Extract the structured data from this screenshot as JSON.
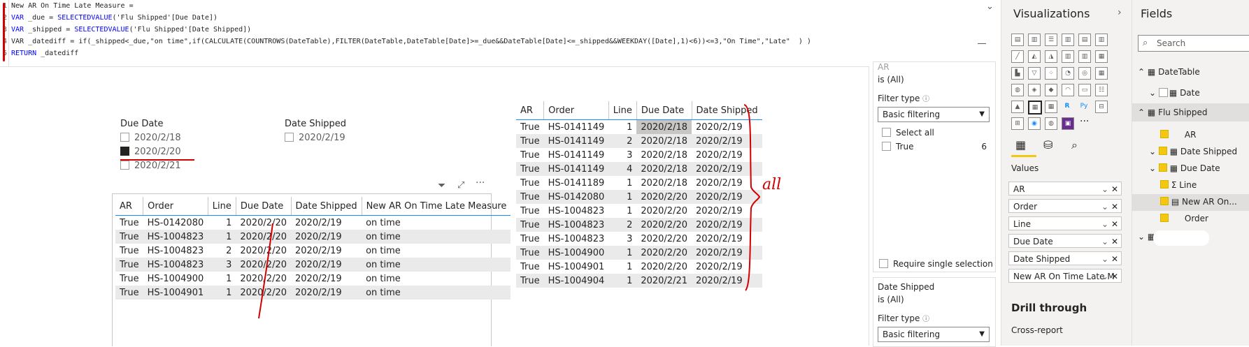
{
  "formula": {
    "line1": {
      "num": "1",
      "text": "New AR On Time Late Measure ="
    },
    "line2": {
      "num": "2",
      "kw": "VAR",
      "name": " _due = ",
      "fn": "SELECTEDVALUE",
      "arg": "('Flu Shipped'[Due Date])"
    },
    "line3": {
      "num": "3",
      "kw": "VAR",
      "name": " _shipped = ",
      "fn": "SELECTEDVALUE",
      "arg": "('Flu Shipped'[Date Shipped])"
    },
    "line4": {
      "num": "4",
      "text": "VAR _datediff = if(_shipped<_due,\"on time\",if(CALCULATE(COUNTROWS(DateTable),FILTER(DateTable,DateTable[Date]>=_due&&DateTable[Date]<=_shipped&&WEEKDAY([Date],1)<6))<=3,\"On Time\",\"Late\"  ) )"
    },
    "line5": {
      "num": "5",
      "kw": "RETURN",
      "name": " _datediff"
    }
  },
  "slicer_due": {
    "title": "Due Date",
    "items": [
      {
        "label": "2020/2/18",
        "checked": false
      },
      {
        "label": "2020/2/20",
        "checked": true
      },
      {
        "label": "2020/2/21",
        "checked": false
      }
    ]
  },
  "slicer_shipped": {
    "title": "Date Shipped",
    "items": [
      {
        "label": "2020/2/19",
        "checked": false
      }
    ]
  },
  "table_left": {
    "headers": [
      "AR",
      "Order",
      "Line",
      "Due Date",
      "Date Shipped",
      "New AR On Time Late Measure"
    ],
    "rows": [
      [
        "True",
        "HS-0142080",
        "1",
        "2020/2/20",
        "2020/2/19",
        "on time"
      ],
      [
        "True",
        "HS-1004823",
        "1",
        "2020/2/20",
        "2020/2/19",
        "on time"
      ],
      [
        "True",
        "HS-1004823",
        "2",
        "2020/2/20",
        "2020/2/19",
        "on time"
      ],
      [
        "True",
        "HS-1004823",
        "3",
        "2020/2/20",
        "2020/2/19",
        "on time"
      ],
      [
        "True",
        "HS-1004900",
        "1",
        "2020/2/20",
        "2020/2/19",
        "on time"
      ],
      [
        "True",
        "HS-1004901",
        "1",
        "2020/2/20",
        "2020/2/19",
        "on time"
      ]
    ]
  },
  "table_right": {
    "headers": [
      "AR",
      "Order",
      "Line",
      "Due Date",
      "Date Shipped"
    ],
    "rows": [
      [
        "True",
        "HS-0141149",
        "1",
        "2020/2/18",
        "2020/2/19"
      ],
      [
        "True",
        "HS-0141149",
        "2",
        "2020/2/18",
        "2020/2/19"
      ],
      [
        "True",
        "HS-0141149",
        "3",
        "2020/2/18",
        "2020/2/19"
      ],
      [
        "True",
        "HS-0141149",
        "4",
        "2020/2/18",
        "2020/2/19"
      ],
      [
        "True",
        "HS-0141189",
        "1",
        "2020/2/18",
        "2020/2/19"
      ],
      [
        "True",
        "HS-0142080",
        "1",
        "2020/2/20",
        "2020/2/19"
      ],
      [
        "True",
        "HS-1004823",
        "1",
        "2020/2/20",
        "2020/2/19"
      ],
      [
        "True",
        "HS-1004823",
        "2",
        "2020/2/20",
        "2020/2/19"
      ],
      [
        "True",
        "HS-1004823",
        "3",
        "2020/2/20",
        "2020/2/19"
      ],
      [
        "True",
        "HS-1004900",
        "1",
        "2020/2/20",
        "2020/2/19"
      ],
      [
        "True",
        "HS-1004901",
        "1",
        "2020/2/20",
        "2020/2/19"
      ],
      [
        "True",
        "HS-1004904",
        "1",
        "2020/2/21",
        "2020/2/19"
      ]
    ]
  },
  "annotation_all": "all",
  "filters": {
    "card1": {
      "field": "AR",
      "value": "is (All)",
      "type_label": "Filter type",
      "type_value": "Basic filtering",
      "select_all": "Select all",
      "opt": "True",
      "opt_count": "6",
      "require": "Require single selection"
    },
    "card2": {
      "field": "Date Shipped",
      "value": "is (All)",
      "type_label": "Filter type",
      "type_value": "Basic filtering"
    }
  },
  "viz": {
    "title": "Visualizations",
    "values_label": "Values",
    "wells": [
      "AR",
      "Order",
      "Line",
      "Due Date",
      "Date Shipped",
      "New AR On Time Late M"
    ],
    "drill": "Drill through",
    "cross": "Cross-report",
    "ellipsis": "···"
  },
  "fields": {
    "title": "Fields",
    "search": "Search",
    "items": [
      {
        "label": "DateTable"
      },
      {
        "label": "Date"
      },
      {
        "label": "Flu Shipped"
      },
      {
        "label": "AR"
      },
      {
        "label": "Date Shipped"
      },
      {
        "label": "Due Date"
      },
      {
        "label": "Line"
      },
      {
        "label": "New AR On..."
      },
      {
        "label": "Order"
      }
    ]
  },
  "colors": {
    "accent": "#118dff",
    "powerbi_yellow": "#f2c811",
    "annotation": "#d40000"
  }
}
